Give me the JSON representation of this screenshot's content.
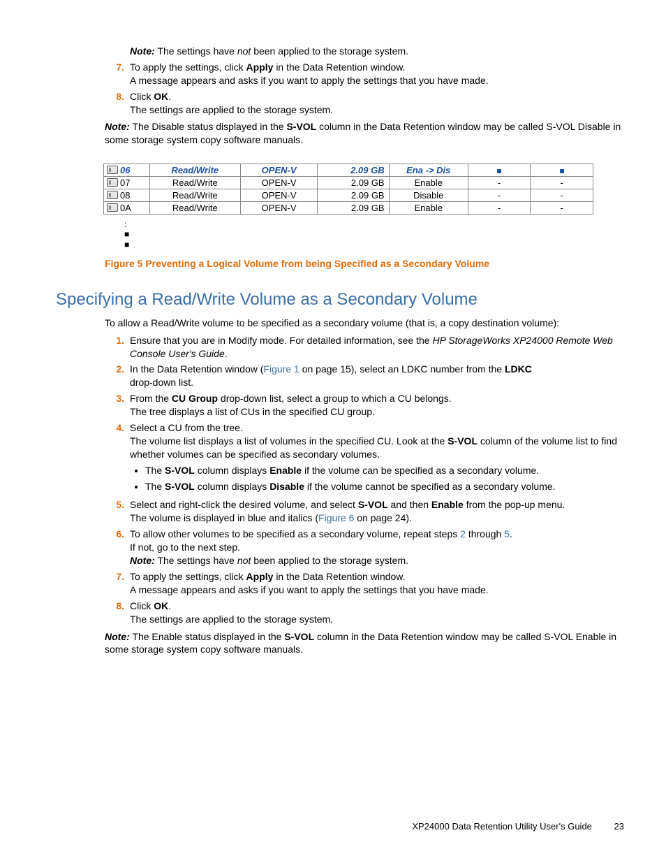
{
  "top": {
    "note6": "The settings have",
    "note6_not": "not",
    "note6_tail": "been applied to the storage system.",
    "s7a": "To apply the settings, click",
    "apply": "Apply",
    "s7b": "in the Data Retention window.",
    "s7c": "A message appears and asks if you want to apply the settings that you have made.",
    "s8a": "Click",
    "ok": "OK",
    "s8b": "The settings are applied to the storage system.",
    "noteD1": "The Disable status displayed in the",
    "svol": "S-VOL",
    "noteD2": "column in the Data Retention window may be called S-VOL Disable in some storage system copy software manuals."
  },
  "table": {
    "rows": [
      {
        "id": "06",
        "rw": "Read/Write",
        "emu": "OPEN-V",
        "cap": "2.09 GB",
        "svol": "Ena -> Dis",
        "c6": "",
        "c7": "",
        "changed": true,
        "dot": true
      },
      {
        "id": "07",
        "rw": "Read/Write",
        "emu": "OPEN-V",
        "cap": "2.09 GB",
        "svol": "Enable",
        "c6": "-",
        "c7": "-",
        "changed": false,
        "dot": false
      },
      {
        "id": "08",
        "rw": "Read/Write",
        "emu": "OPEN-V",
        "cap": "2.09 GB",
        "svol": "Disable",
        "c6": "-",
        "c7": "-",
        "changed": false,
        "dot": false
      },
      {
        "id": "0A",
        "rw": "Read/Write",
        "emu": "OPEN-V",
        "cap": "2.09 GB",
        "svol": "Enable",
        "c6": "-",
        "c7": "-",
        "changed": false,
        "dot": false
      }
    ]
  },
  "figcap": "Figure 5 Preventing a Logical Volume from being Specified as a Secondary Volume",
  "heading": "Specifying a Read/Write Volume as a Secondary Volume",
  "intro": "To allow a Read/Write volume to be specified as a secondary volume (that is, a copy destination volume):",
  "sec": {
    "s1a": "Ensure that you are in Modify mode.  For detailed information, see the",
    "s1b": "HP StorageWorks XP24000 Remote Web Console User's Guide",
    "s2a": "In the Data Retention window (",
    "fig1": "Figure 1",
    "s2b": " on page 15), select an LDKC number from the",
    "ldkc": "LDKC",
    "s2c": "drop-down list.",
    "s3a": "From the",
    "cugroup": "CU Group",
    "s3b": "drop-down list, select a group to which a CU belongs.",
    "s3c": "The tree displays a list of CUs in the specified CU group.",
    "s4a": "Select a CU from the tree.",
    "s4b": "The volume list displays a list of volumes in the specified CU. Look at the",
    "svol": "S-VOL",
    "s4c": "column of the volume list to find whether volumes can be specified as secondary volumes.",
    "b1a": "The",
    "b1b": "column displays",
    "enable": "Enable",
    "b1c": "if the volume can be specified as a secondary volume.",
    "disable": "Disable",
    "b2c": "if the volume cannot be specified as a secondary volume.",
    "s5a": "Select and right-click the desired volume, and select",
    "s5b": "and then",
    "s5c": "from the pop-up menu.",
    "s5d": "The volume is displayed in blue and italics (",
    "fig6": "Figure 6",
    "s5e": " on page 24).",
    "s6a": "To allow other volumes to be specified as a secondary volume, repeat steps",
    "two": "2",
    "s6b": "through",
    "five": "5",
    "s6c": "If not, go to the next step.",
    "s6d": "The settings have",
    "not": "not",
    "s6e": "been applied to the storage system.",
    "s7a": "To apply the settings, click",
    "apply": "Apply",
    "s7b": "in the Data Retention window.",
    "s7c": "A message appears and asks if you want to apply the settings that you have made.",
    "s8a": "Click",
    "ok": "OK",
    "s8b": "The settings are applied to the storage system.",
    "noteE1": "The Enable status displayed in the",
    "noteE2": "column in the Data Retention window may be called S-VOL Enable in some storage system copy software manuals."
  },
  "footer": {
    "title": "XP24000 Data Retention Utility User's Guide",
    "page": "23"
  },
  "labels": {
    "note": "Note:",
    "n7": "7.",
    "n8": "8.",
    "n1": "1.",
    "n2": "2.",
    "n3": "3.",
    "n4": "4.",
    "n5": "5.",
    "n6": "6.",
    "dot": ":",
    "sq": "■",
    "period": "."
  }
}
